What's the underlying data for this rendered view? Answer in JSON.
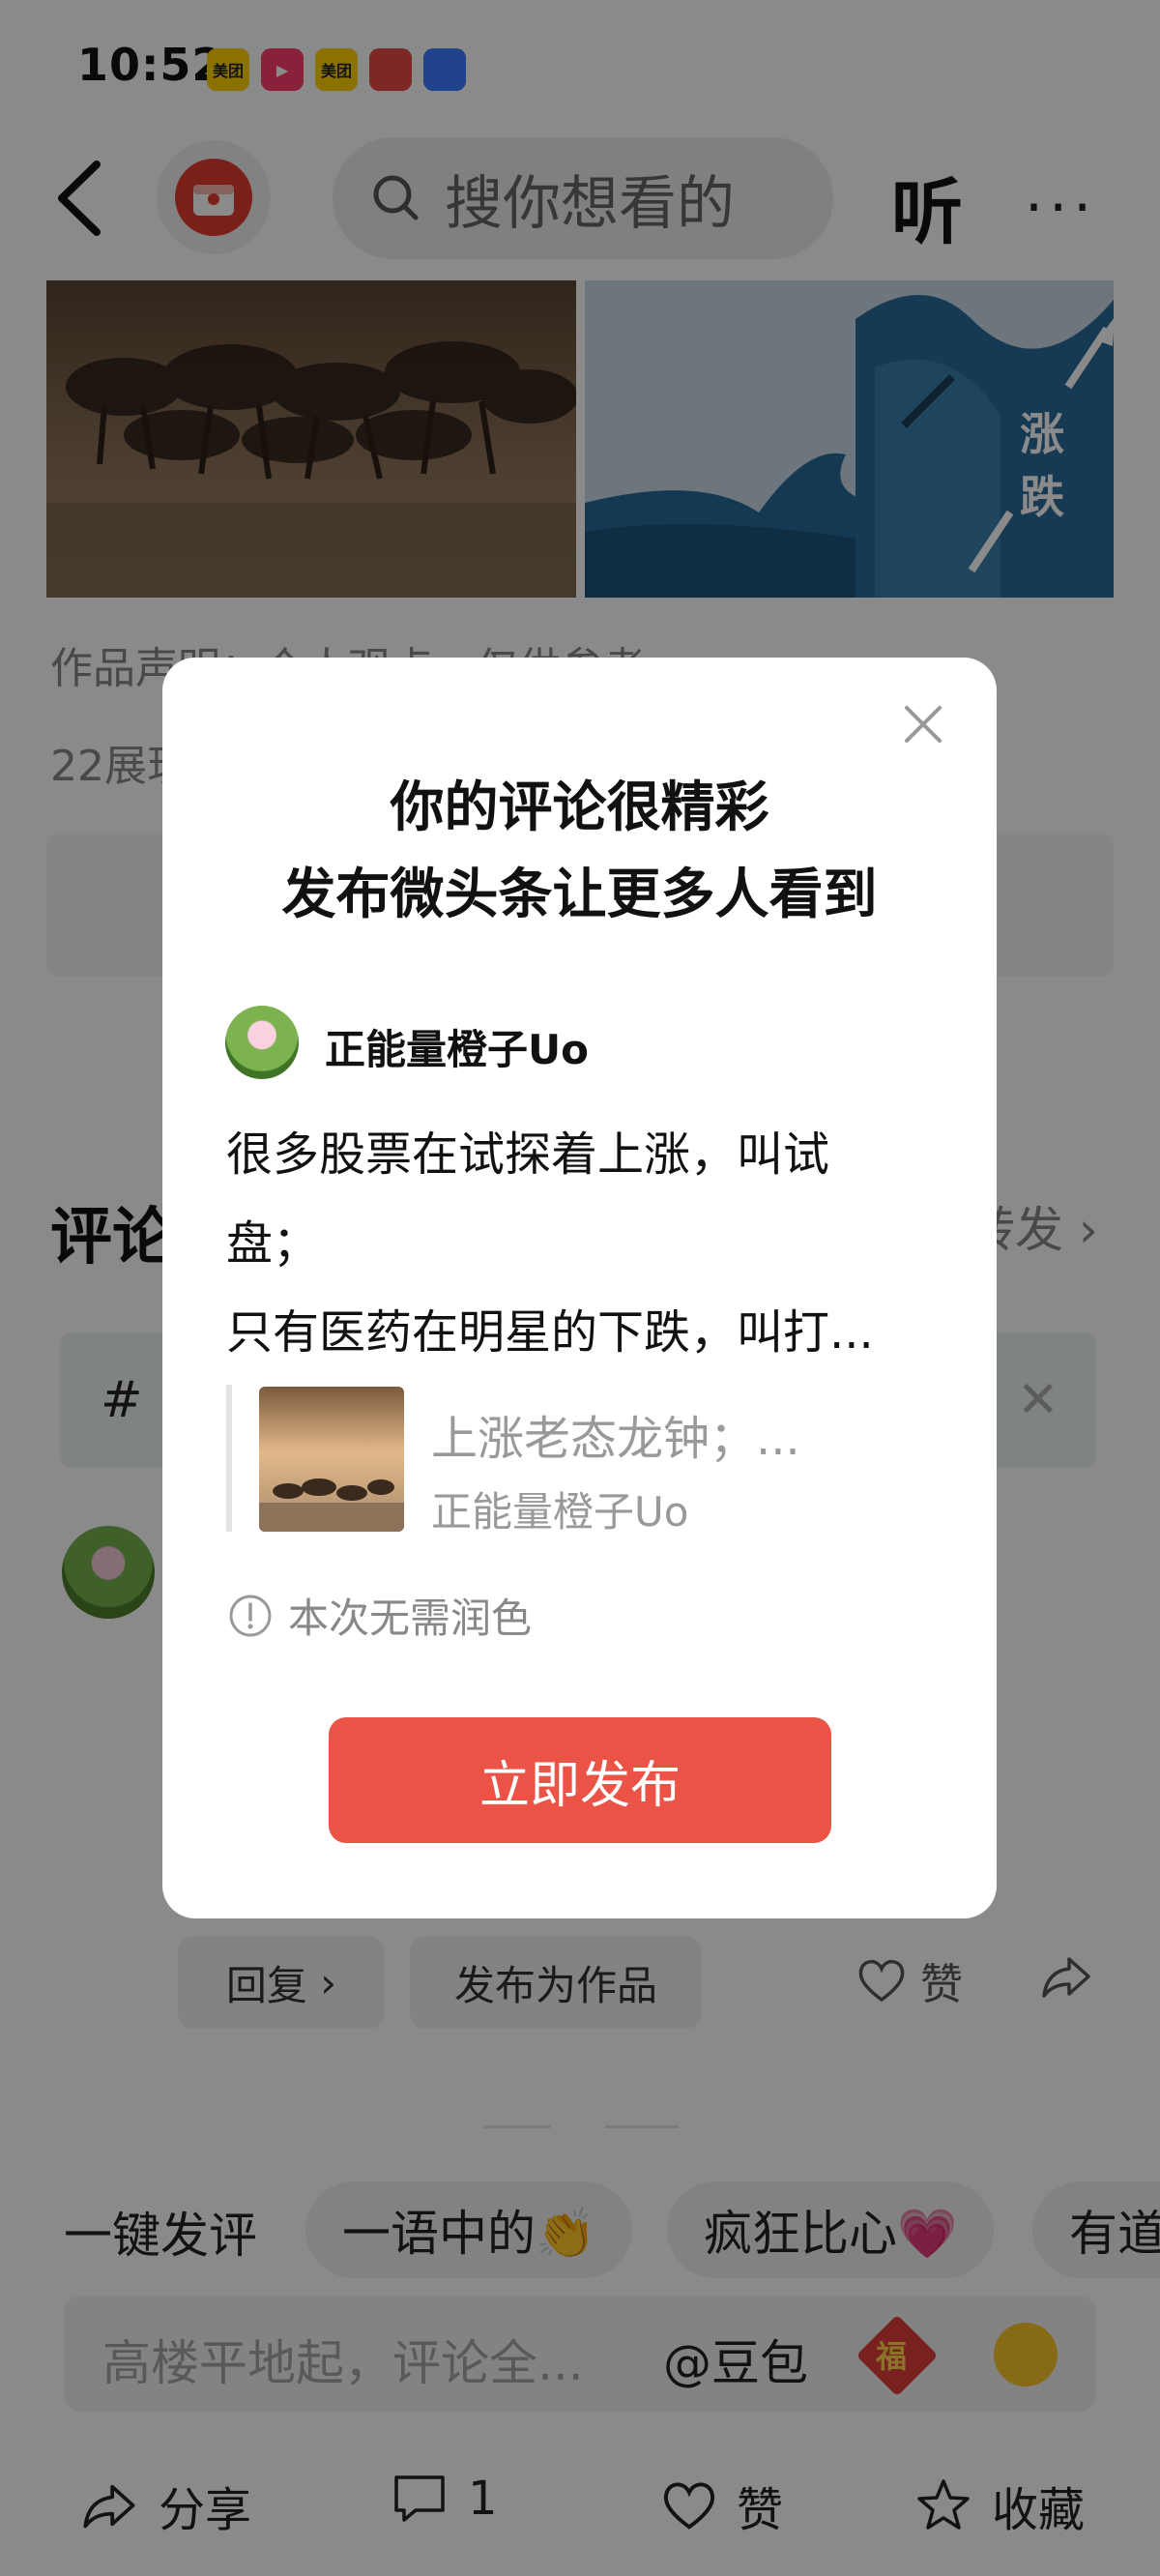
{
  "status_bar": {
    "time": "10:52",
    "apps": [
      {
        "label": "美团",
        "color": "#ffd100"
      },
      {
        "label": "▶",
        "color": "#ff3d6e"
      },
      {
        "label": "美团",
        "color": "#ffd100"
      },
      {
        "label": "",
        "color": "#e84b45"
      },
      {
        "label": "",
        "color": "#3a7bff"
      }
    ]
  },
  "nav": {
    "search_placeholder": "搜你想看的",
    "listen_label": "听",
    "more_label": "···"
  },
  "article": {
    "declaration": "作品声明：个人观点，仅供参考",
    "views": "22展现",
    "right_image_text": [
      "涨",
      "跌"
    ]
  },
  "comments": {
    "heading": "评论",
    "repost_label": "转发",
    "reply_label": "回复",
    "publish_as_work_label": "发布为作品",
    "like_label": "赞"
  },
  "quick_comments": {
    "label": "一键发评",
    "chips": [
      "一语中的👏",
      "疯狂比心💗",
      "有道"
    ]
  },
  "input_bar": {
    "placeholder": "高楼平地起，评论全...",
    "doubao_label": "@豆包",
    "fu_label": "福"
  },
  "bottom_bar": {
    "share_label": "分享",
    "comment_count": "1",
    "like_label": "赞",
    "favorite_label": "收藏"
  },
  "modal": {
    "title_line1": "你的评论很精彩",
    "title_line2": "发布微头条让更多人看到",
    "author_name": "正能量橙子Uo",
    "comment_text_line1": "很多股票在试探着上涨，叫试",
    "comment_text_line2": "盘；",
    "comment_text_line3": "只有医药在明星的下跌，叫打...",
    "quote_title": "上涨老态龙钟；...",
    "quote_author": "正能量橙子Uo",
    "notice": "本次无需润色",
    "publish_button": "立即发布"
  },
  "colors": {
    "accent": "#ea5346",
    "overlay": "rgba(0,0,0,0.46)"
  }
}
